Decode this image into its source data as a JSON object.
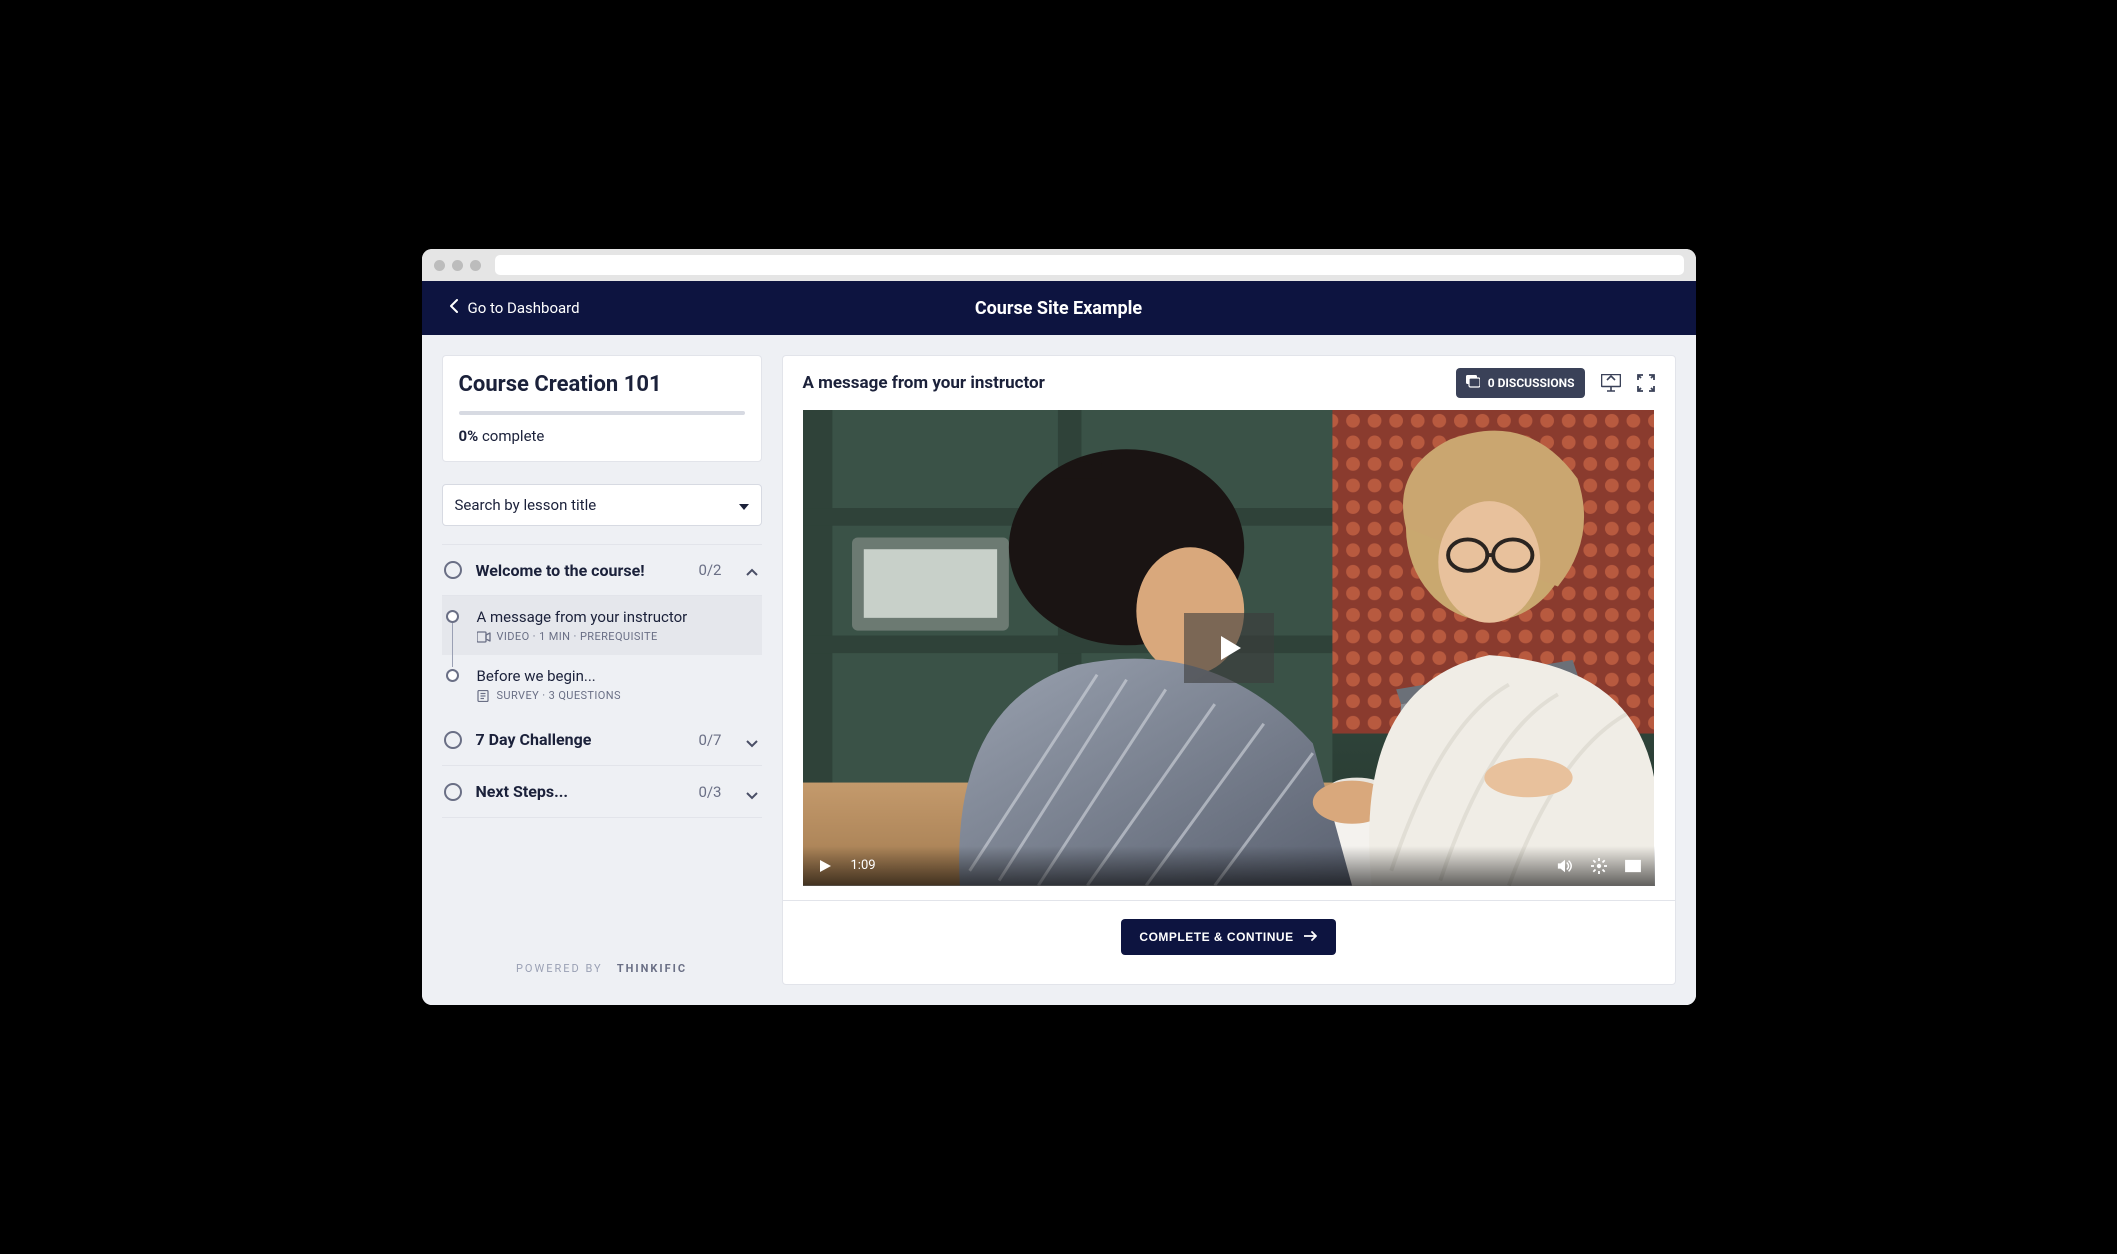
{
  "nav": {
    "back_label": "Go to Dashboard",
    "site_title": "Course Site Example"
  },
  "course": {
    "title": "Course Creation 101",
    "percent": "0%",
    "complete_word": "complete"
  },
  "search": {
    "placeholder": "Search by lesson title"
  },
  "chapters": [
    {
      "title": "Welcome to the course!",
      "count": "0/2",
      "expanded": true
    },
    {
      "title": "7 Day Challenge",
      "count": "0/7",
      "expanded": false
    },
    {
      "title": "Next Steps...",
      "count": "0/3",
      "expanded": false
    }
  ],
  "lessons_ch1": [
    {
      "name": "A message from your instructor",
      "meta": "VIDEO · 1 MIN  ·  PREREQUISITE",
      "icon": "video",
      "active": true
    },
    {
      "name": "Before we begin...",
      "meta": "SURVEY · 3 QUESTIONS",
      "icon": "survey",
      "active": false
    }
  ],
  "main": {
    "lesson_title": "A message from your instructor",
    "discussions": "0 DISCUSSIONS",
    "video_time": "1:09",
    "complete_label": "COMPLETE & CONTINUE"
  },
  "footer": {
    "powered": "POWERED BY",
    "brand": "THINKIFIC"
  }
}
